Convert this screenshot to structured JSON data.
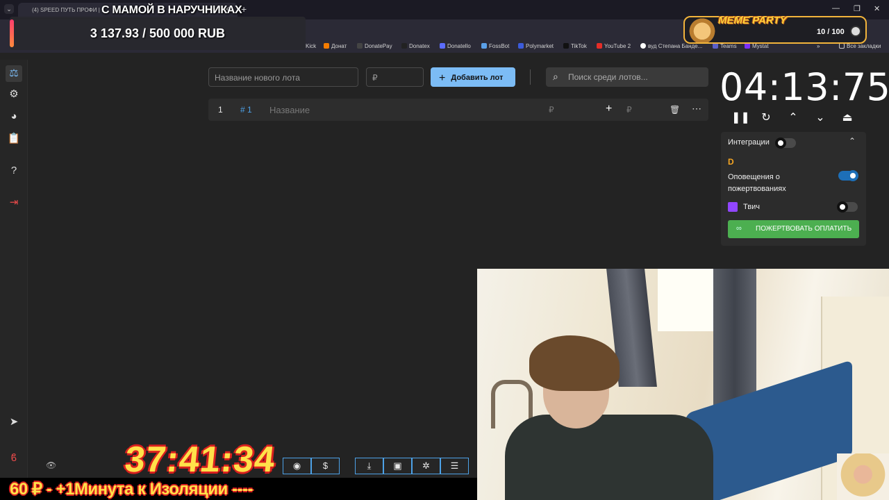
{
  "browser": {
    "tab_title": "(4) SPEED ПУТЬ ПРОФИ | 1",
    "bookmarks": [
      "Kick",
      "Донат",
      "DonatePay",
      "Donatex",
      "Donatello",
      "FossBot",
      "Polymarket",
      "TikTok",
      "YouTube 2",
      "вуд Степана Бандe...",
      "Teams",
      "Mystat",
      "Все закладки"
    ]
  },
  "overlay": {
    "stream_title": "С МАМОЙ В НАРУЧНИКАХ",
    "donation_amount": "3 137.93 / 500 000 RUB",
    "meme_title": "MEME PARTY",
    "meme_count": "10 / 100",
    "big_timer": "37:41:34",
    "ticker": "60 ₽ - +1Минута к Изоляции ----"
  },
  "main": {
    "new_lot_placeholder": "Название нового лота",
    "currency": "₽",
    "add_lot_label": "Добавить лот",
    "search_placeholder": "Поиск среди лотов...",
    "lot": {
      "index": "1",
      "tag": "# 1",
      "name_placeholder": "Название",
      "currency": "₽"
    }
  },
  "timer": {
    "value": "04:13:75"
  },
  "integrations": {
    "title": "Интеграции",
    "donation_alerts_label": "Оповещения о пожертвованиях",
    "twitch_label": "Твич",
    "pay_button": "ПОЖЕРТВОВАТЬ ОПЛАТИТЬ"
  },
  "colors": {
    "accent_blue": "#7cbcf5",
    "pay_green": "#4caf50",
    "timer_yellow": "#ffe14a"
  }
}
